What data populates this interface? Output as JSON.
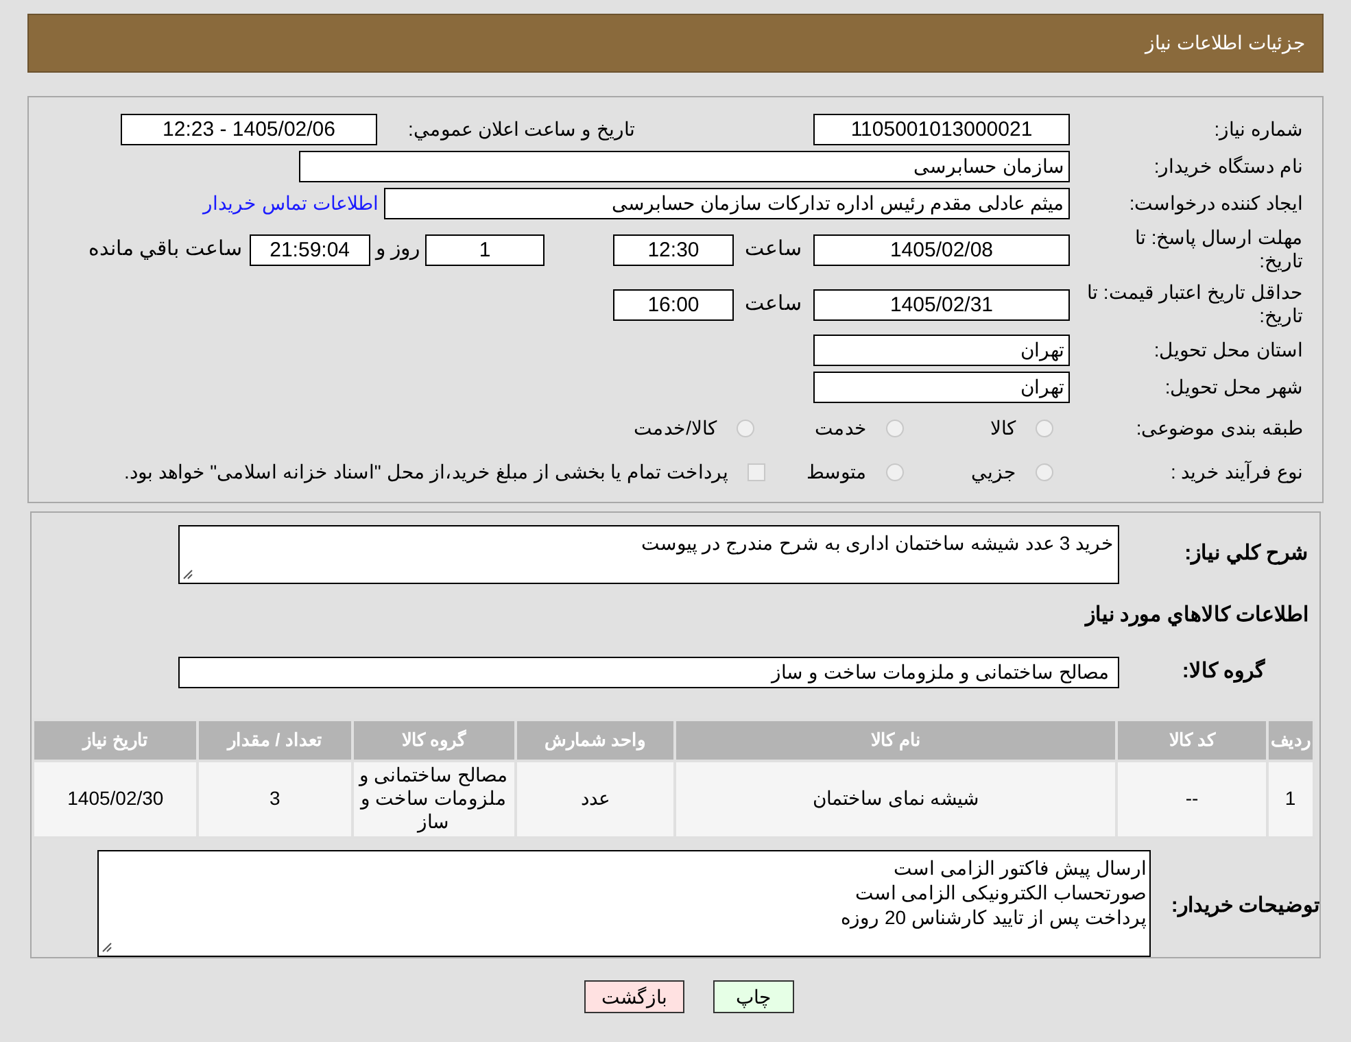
{
  "header": {
    "title": "جزئيات اطلاعات نیاز"
  },
  "need_number": {
    "label": "شماره نیاز:",
    "value": "1105001013000021"
  },
  "announce": {
    "label": "تاريخ و ساعت اعلان عمومي:",
    "value": "1405/02/06 - 12:23"
  },
  "buyer_org": {
    "label": "نام دستگاه خريدار:",
    "value": "سازمان حسابرسی"
  },
  "creator": {
    "label": "ایجاد کننده درخواست:",
    "value": "میثم عادلی مقدم رئیس اداره تدارکات سازمان حسابرسی",
    "link": "اطلاعات تماس خريدار"
  },
  "reply_deadline": {
    "label": "مهلت ارسال پاسخ: تا تاریخ:",
    "date": "1405/02/08",
    "time_label": "ساعت",
    "time": "12:30",
    "days": "1",
    "days_label": "روز و",
    "remaining": "21:59:04",
    "remaining_label": "ساعت باقي مانده"
  },
  "price_validity": {
    "label": "حداقل تاريخ اعتبار قيمت: تا تاریخ:",
    "date": "1405/02/31",
    "time_label": "ساعت",
    "time": "16:00"
  },
  "province": {
    "label": "استان محل تحويل:",
    "value": "تهران"
  },
  "city": {
    "label": "شهر محل تحويل:",
    "value": "تهران"
  },
  "category": {
    "label": "طبقه بندی موضوعی:",
    "options": [
      {
        "label": "كالا",
        "selected": false
      },
      {
        "label": "خدمت",
        "selected": false
      },
      {
        "label": "كالا/خدمت",
        "selected": false
      }
    ]
  },
  "process": {
    "label": "نوع فرآیند خرید :",
    "options": [
      {
        "label": "جزيي",
        "selected": false
      },
      {
        "label": "متوسط",
        "selected": false
      }
    ],
    "payment_note": {
      "label": "پرداخت تمام یا بخشی از مبلغ خرید،از محل \"اسناد خزانه اسلامی\" خواهد بود.",
      "checked": false
    }
  },
  "description": {
    "label": "شرح كلي نياز:",
    "value": "خرید 3 عدد شیشه ساختمان اداری به شرح مندرج در پیوست"
  },
  "goods_heading": "اطلاعات كالاهاي مورد نياز",
  "goods_group": {
    "label": "گروه كالا:",
    "value": "مصالح ساختمانی و ملزومات ساخت و ساز"
  },
  "table": {
    "columns": [
      "رديف",
      "كد كالا",
      "نام كالا",
      "واحد شمارش",
      "گروه كالا",
      "تعداد / مقدار",
      "تاريخ نياز"
    ],
    "rows": [
      [
        "1",
        "--",
        "شیشه نمای ساختمان",
        "عدد",
        "مصالح ساختمانی و ملزومات ساخت و ساز",
        "3",
        "1405/02/30"
      ]
    ]
  },
  "buyer_notes": {
    "label": "توضيحات خريدار:",
    "lines": [
      "ارسال پیش فاکتور الزامی است",
      "صورتحساب الکترونیکی الزامی است",
      "پرداخت پس از تایید کارشناس 20 روزه"
    ]
  },
  "buttons": [
    {
      "kind": "print",
      "label": "چاپ"
    },
    {
      "kind": "back",
      "label": "بازگشت"
    }
  ]
}
